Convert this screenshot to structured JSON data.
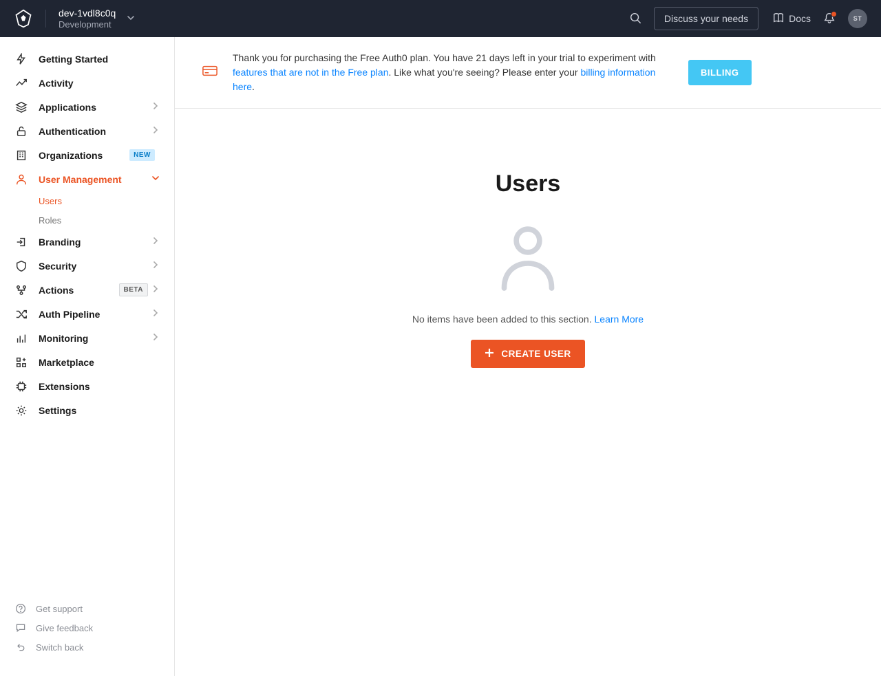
{
  "header": {
    "tenant_name": "dev-1vdl8c0q",
    "tenant_env": "Development",
    "discuss_label": "Discuss your needs",
    "docs_label": "Docs",
    "avatar_initials": "ST"
  },
  "banner": {
    "text_a": "Thank you for purchasing the Free Auth0 plan. You have 21 days left in your trial to experiment with ",
    "link_a": "features that are not in the Free plan",
    "text_b": ". Like what you're seeing? Please enter your ",
    "link_b": "billing information here",
    "text_c": ".",
    "billing_btn": "BILLING"
  },
  "sidebar": {
    "items": [
      {
        "label": "Getting Started",
        "icon": "zap",
        "chev": false
      },
      {
        "label": "Activity",
        "icon": "trend",
        "chev": false
      },
      {
        "label": "Applications",
        "icon": "layers",
        "chev": true
      },
      {
        "label": "Authentication",
        "icon": "lock",
        "chev": true
      },
      {
        "label": "Organizations",
        "icon": "building",
        "badge": "NEW"
      },
      {
        "label": "User Management",
        "icon": "user",
        "chev": true,
        "active": true,
        "open": true,
        "sub": [
          {
            "label": "Users",
            "active": true
          },
          {
            "label": "Roles"
          }
        ]
      },
      {
        "label": "Branding",
        "icon": "login",
        "chev": true
      },
      {
        "label": "Security",
        "icon": "shield",
        "chev": true
      },
      {
        "label": "Actions",
        "icon": "flow",
        "badge": "BETA",
        "chev": true
      },
      {
        "label": "Auth Pipeline",
        "icon": "shuffle",
        "chev": true
      },
      {
        "label": "Monitoring",
        "icon": "bars",
        "chev": true
      },
      {
        "label": "Marketplace",
        "icon": "grid-plus",
        "chev": false
      },
      {
        "label": "Extensions",
        "icon": "chip",
        "chev": false
      },
      {
        "label": "Settings",
        "icon": "gear",
        "chev": false
      }
    ],
    "footer": [
      {
        "label": "Get support",
        "icon": "help"
      },
      {
        "label": "Give feedback",
        "icon": "chat"
      },
      {
        "label": "Switch back",
        "icon": "undo"
      }
    ]
  },
  "page": {
    "title": "Users",
    "empty_text": "No items have been added to this section. ",
    "learn_more": "Learn More",
    "create_label": "CREATE USER"
  }
}
